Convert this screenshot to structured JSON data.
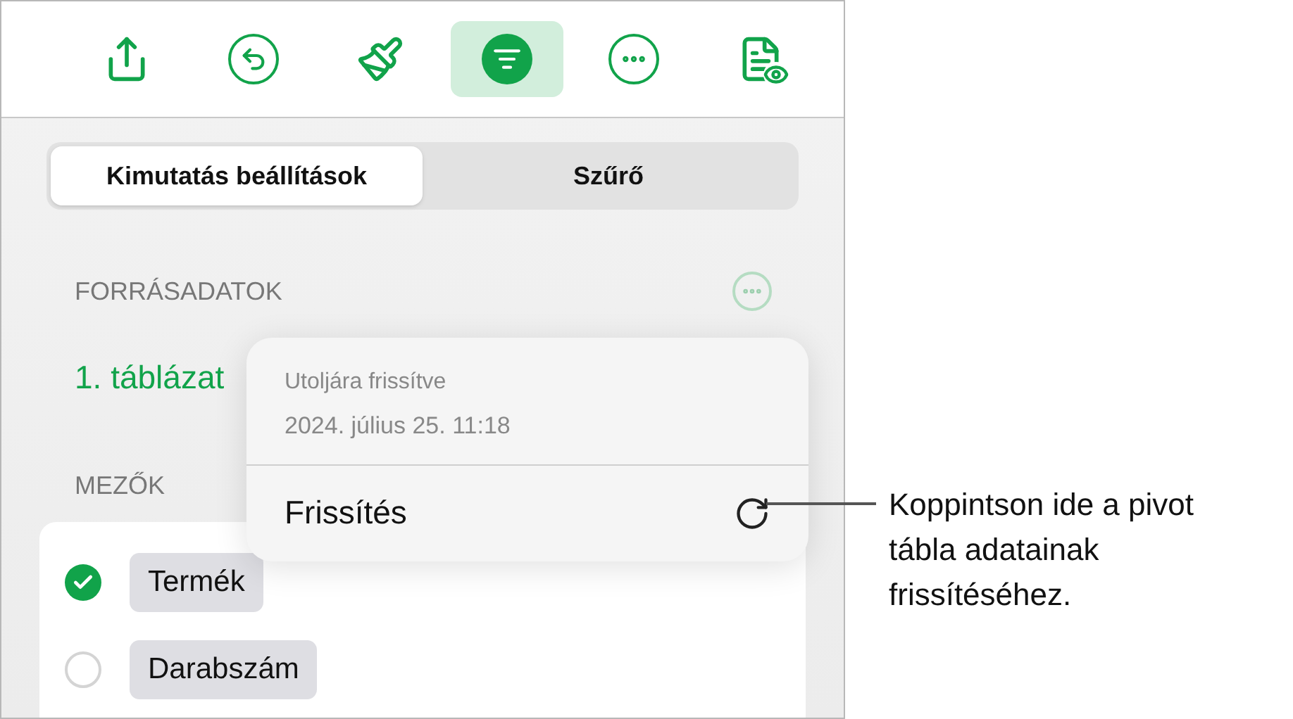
{
  "toolbar": [
    {
      "kind": "share",
      "selected": false
    },
    {
      "kind": "undo",
      "selected": false
    },
    {
      "kind": "brush",
      "selected": false
    },
    {
      "kind": "filter",
      "selected": true
    },
    {
      "kind": "more",
      "selected": false
    },
    {
      "kind": "preview",
      "selected": false
    }
  ],
  "segments": [
    {
      "label": "Kimutatás beállítások",
      "selected": true
    },
    {
      "label": "Szűrő",
      "selected": false
    }
  ],
  "source": {
    "heading": "FORRÁSADATOK",
    "table": "1. táblázat"
  },
  "fields": {
    "heading": "MEZŐK",
    "items": [
      {
        "label": "Termék",
        "checked": true
      },
      {
        "label": "Darabszám",
        "checked": false
      }
    ]
  },
  "popover": {
    "caption": "Utoljára frissítve",
    "date": "2024. július 25. 11:18",
    "action": "Frissítés"
  },
  "callout": "Koppintson ide a pivot tábla adatainak frissítéséhez."
}
